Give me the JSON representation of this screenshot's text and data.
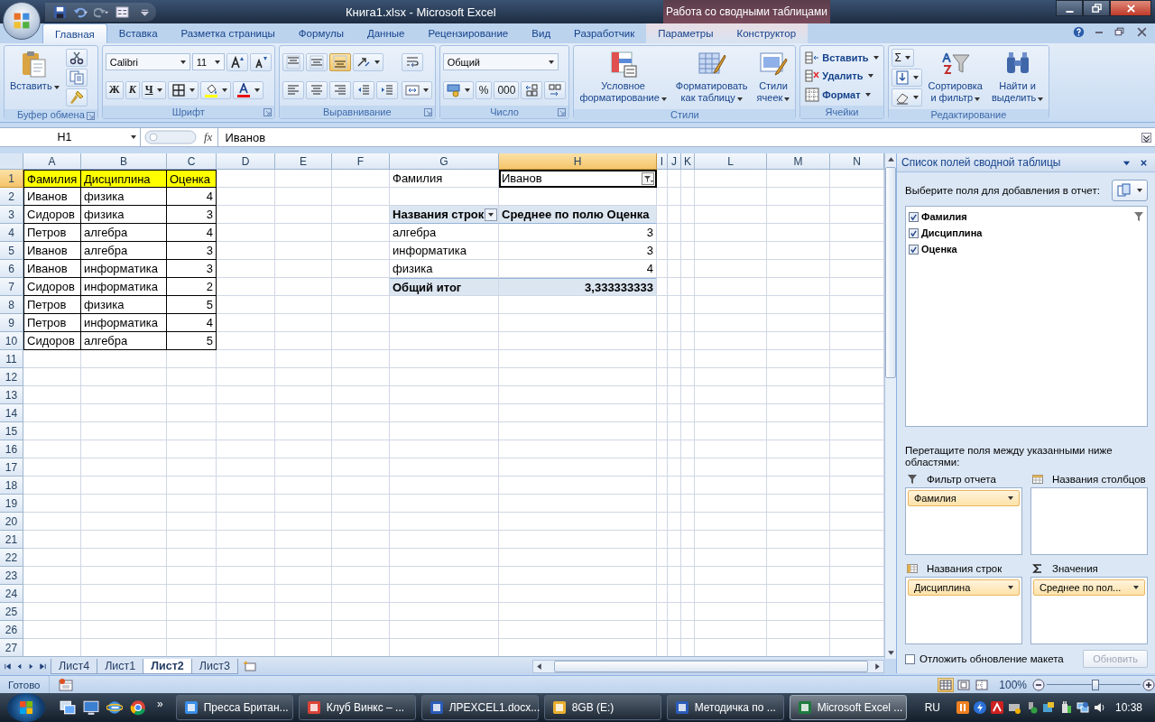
{
  "window": {
    "title": "Книга1.xlsx - Microsoft Excel",
    "context_group": "Работа со сводными таблицами"
  },
  "ribbon": {
    "tabs": [
      {
        "label": "Главная",
        "selected": true,
        "contextual": false
      },
      {
        "label": "Вставка",
        "selected": false,
        "contextual": false
      },
      {
        "label": "Разметка страницы",
        "selected": false,
        "contextual": false
      },
      {
        "label": "Формулы",
        "selected": false,
        "contextual": false
      },
      {
        "label": "Данные",
        "selected": false,
        "contextual": false
      },
      {
        "label": "Рецензирование",
        "selected": false,
        "contextual": false
      },
      {
        "label": "Вид",
        "selected": false,
        "contextual": false
      },
      {
        "label": "Разработчик",
        "selected": false,
        "contextual": false
      },
      {
        "label": "Параметры",
        "selected": false,
        "contextual": true
      },
      {
        "label": "Конструктор",
        "selected": false,
        "contextual": true
      }
    ],
    "groups": [
      {
        "label": "Буфер обмена",
        "launcher": true,
        "columns": [
          [
            [
              {
                "kind": "large",
                "label": "Вставить",
                "dropdown": true
              }
            ]
          ],
          [
            [
              {
                "kind": "icon",
                "dropdown": false
              }
            ],
            [
              {
                "kind": "icon",
                "dropdown": false
              }
            ],
            [
              {
                "kind": "icon",
                "dropdown": false
              }
            ]
          ]
        ]
      },
      {
        "label": "Шрифт",
        "launcher": true,
        "columns": [
          [
            [
              {
                "kind": "combo",
                "value": "Calibri",
                "wide": true
              },
              {
                "kind": "combo",
                "value": "11",
                "wide": false
              },
              {
                "kind": "icon",
                "dropdown": false
              },
              {
                "kind": "icon",
                "dropdown": false
              }
            ],
            [
              {
                "kind": "text",
                "label": "Ж",
                "dropdown": false
              },
              {
                "kind": "text",
                "label": "К",
                "dropdown": false
              },
              {
                "kind": "text",
                "label": "Ч",
                "dropdown": true
              },
              {
                "kind": "icon",
                "dropdown": true
              },
              {
                "kind": "icon",
                "dropdown": true
              },
              {
                "kind": "icon",
                "dropdown": true
              }
            ]
          ]
        ]
      },
      {
        "label": "Выравнивание",
        "launcher": true,
        "columns": [
          [
            [
              {
                "kind": "icon",
                "dropdown": false,
                "on": false
              },
              {
                "kind": "icon",
                "dropdown": false,
                "on": false
              },
              {
                "kind": "icon",
                "dropdown": false,
                "on": true
              },
              {
                "kind": "icon",
                "dropdown": true,
                "on": false
              }
            ],
            [
              {
                "kind": "icon",
                "dropdown": false,
                "on": false
              },
              {
                "kind": "icon",
                "dropdown": false,
                "on": false
              },
              {
                "kind": "icon",
                "dropdown": false,
                "on": false
              },
              {
                "kind": "icon",
                "dropdown": false,
                "on": false
              },
              {
                "kind": "icon",
                "dropdown": false,
                "on": false
              }
            ]
          ],
          [
            [
              {
                "kind": "icon",
                "dropdown": false
              }
            ],
            [
              {
                "kind": "icon",
                "dropdown": true
              }
            ]
          ]
        ]
      },
      {
        "label": "Число",
        "launcher": true,
        "columns": [
          [
            [
              {
                "kind": "combo",
                "value": "Общий",
                "wide": true
              }
            ],
            [
              {
                "kind": "icon",
                "dropdown": true
              },
              {
                "kind": "text",
                "label": "%",
                "dropdown": false
              },
              {
                "kind": "text",
                "label": "000",
                "dropdown": false
              },
              {
                "kind": "icon",
                "dropdown": false
              },
              {
                "kind": "icon",
                "dropdown": false
              }
            ]
          ]
        ]
      },
      {
        "label": "Стили",
        "launcher": false,
        "columns": [
          [
            [
              {
                "kind": "large",
                "label": "Условное\nформатирование",
                "dropdown": true
              }
            ]
          ],
          [
            [
              {
                "kind": "large",
                "label": "Форматировать\nкак таблицу",
                "dropdown": true
              }
            ]
          ],
          [
            [
              {
                "kind": "large",
                "label": "Стили\nячеек",
                "dropdown": true
              }
            ]
          ]
        ]
      },
      {
        "label": "Ячейки",
        "launcher": false,
        "columns": [
          [
            [
              {
                "kind": "small",
                "label": "Вставить",
                "dropdown": true
              }
            ],
            [
              {
                "kind": "small",
                "label": "Удалить",
                "dropdown": true
              }
            ],
            [
              {
                "kind": "small",
                "label": "Формат",
                "dropdown": true
              }
            ]
          ]
        ]
      },
      {
        "label": "Редактирование",
        "launcher": false,
        "columns": [
          [
            [
              {
                "kind": "text",
                "label": "Σ",
                "dropdown": true
              }
            ],
            [
              {
                "kind": "icon",
                "dropdown": true
              }
            ],
            [
              {
                "kind": "icon",
                "dropdown": true
              }
            ]
          ],
          [
            [
              {
                "kind": "large",
                "label": "Сортировка\nи фильтр",
                "dropdown": true
              }
            ]
          ],
          [
            [
              {
                "kind": "large",
                "label": "Найти и\nвыделить",
                "dropdown": true
              }
            ]
          ]
        ]
      }
    ]
  },
  "formula_bar": {
    "name_box": "H1",
    "function_label": "fx",
    "value": "Иванов"
  },
  "grid": {
    "columns": [
      {
        "label": "A",
        "selected": false
      },
      {
        "label": "B",
        "selected": false
      },
      {
        "label": "C",
        "selected": false
      },
      {
        "label": "D",
        "selected": false
      },
      {
        "label": "E",
        "selected": false
      },
      {
        "label": "F",
        "selected": false
      },
      {
        "label": "G",
        "selected": false
      },
      {
        "label": "H",
        "selected": true
      },
      {
        "label": "I",
        "selected": false
      },
      {
        "label": "J",
        "selected": false
      },
      {
        "label": "K",
        "selected": false
      },
      {
        "label": "L",
        "selected": false
      },
      {
        "label": "M",
        "selected": false
      },
      {
        "label": "N",
        "selected": false
      }
    ],
    "rows": [
      {
        "header": "1",
        "selected": true,
        "cells": [
          {
            "text": "Фамилия",
            "kind": "header",
            "selected": false
          },
          {
            "text": "Дисциплина",
            "kind": "header",
            "selected": false
          },
          {
            "text": "Оценка",
            "kind": "header",
            "selected": false
          },
          null,
          null,
          null,
          {
            "text": "Фамилия",
            "kind": "label",
            "selected": false
          },
          {
            "text": "Иванов",
            "kind": "filter",
            "selected": true
          },
          null,
          null,
          null,
          null,
          null,
          null
        ]
      },
      {
        "header": "2",
        "selected": false,
        "cells": [
          {
            "text": "Иванов",
            "kind": "text",
            "selected": false
          },
          {
            "text": "физика",
            "kind": "text",
            "selected": false
          },
          {
            "text": "4",
            "kind": "number",
            "selected": false
          },
          null,
          null,
          null,
          null,
          null,
          null,
          null,
          null,
          null,
          null,
          null
        ]
      },
      {
        "header": "3",
        "selected": false,
        "cells": [
          {
            "text": "Сидоров",
            "kind": "text",
            "selected": false
          },
          {
            "text": "физика",
            "kind": "text",
            "selected": false
          },
          {
            "text": "3",
            "kind": "number",
            "selected": false
          },
          null,
          null,
          null,
          {
            "text": "Названия строк",
            "kind": "rowheading",
            "selected": false
          },
          {
            "text": "Среднее по полю Оценка",
            "kind": "heading",
            "selected": false
          },
          null,
          null,
          null,
          null,
          null,
          null
        ]
      },
      {
        "header": "4",
        "selected": false,
        "cells": [
          {
            "text": "Петров",
            "kind": "text",
            "selected": false
          },
          {
            "text": "алгебра",
            "kind": "text",
            "selected": false
          },
          {
            "text": "4",
            "kind": "number",
            "selected": false
          },
          null,
          null,
          null,
          {
            "text": "алгебра",
            "kind": "item",
            "selected": false
          },
          {
            "text": "3",
            "kind": "value",
            "selected": false
          },
          null,
          null,
          null,
          null,
          null,
          null
        ]
      },
      {
        "header": "5",
        "selected": false,
        "cells": [
          {
            "text": "Иванов",
            "kind": "text",
            "selected": false
          },
          {
            "text": "алгебра",
            "kind": "text",
            "selected": false
          },
          {
            "text": "3",
            "kind": "number",
            "selected": false
          },
          null,
          null,
          null,
          {
            "text": "информатика",
            "kind": "item",
            "selected": false
          },
          {
            "text": "3",
            "kind": "value",
            "selected": false
          },
          null,
          null,
          null,
          null,
          null,
          null
        ]
      },
      {
        "header": "6",
        "selected": false,
        "cells": [
          {
            "text": "Иванов",
            "kind": "text",
            "selected": false
          },
          {
            "text": "информатика",
            "kind": "text",
            "selected": false
          },
          {
            "text": "3",
            "kind": "number",
            "selected": false
          },
          null,
          null,
          null,
          {
            "text": "физика",
            "kind": "item",
            "selected": false
          },
          {
            "text": "4",
            "kind": "value",
            "selected": false
          },
          null,
          null,
          null,
          null,
          null,
          null
        ]
      },
      {
        "header": "7",
        "selected": false,
        "cells": [
          {
            "text": "Сидоров",
            "kind": "text",
            "selected": false
          },
          {
            "text": "информатика",
            "kind": "text",
            "selected": false
          },
          {
            "text": "2",
            "kind": "number",
            "selected": false
          },
          null,
          null,
          null,
          {
            "text": "Общий итог",
            "kind": "total",
            "selected": false
          },
          {
            "text": "3,333333333",
            "kind": "totalvalue",
            "selected": false
          },
          null,
          null,
          null,
          null,
          null,
          null
        ]
      },
      {
        "header": "8",
        "selected": false,
        "cells": [
          {
            "text": "Петров",
            "kind": "text",
            "selected": false
          },
          {
            "text": "физика",
            "kind": "text",
            "selected": false
          },
          {
            "text": "5",
            "kind": "number",
            "selected": false
          },
          null,
          null,
          null,
          null,
          null,
          null,
          null,
          null,
          null,
          null,
          null
        ]
      },
      {
        "header": "9",
        "selected": false,
        "cells": [
          {
            "text": "Петров",
            "kind": "text",
            "selected": false
          },
          {
            "text": "информатика",
            "kind": "text",
            "selected": false
          },
          {
            "text": "4",
            "kind": "number",
            "selected": false
          },
          null,
          null,
          null,
          null,
          null,
          null,
          null,
          null,
          null,
          null,
          null
        ]
      },
      {
        "header": "10",
        "selected": false,
        "cells": [
          {
            "text": "Сидоров",
            "kind": "text",
            "selected": false
          },
          {
            "text": "алгебра",
            "kind": "text",
            "selected": false
          },
          {
            "text": "5",
            "kind": "number",
            "selected": false
          },
          null,
          null,
          null,
          null,
          null,
          null,
          null,
          null,
          null,
          null,
          null
        ]
      },
      {
        "header": "11",
        "selected": false
      },
      {
        "header": "12",
        "selected": false
      },
      {
        "header": "13",
        "selected": false
      },
      {
        "header": "14",
        "selected": false
      },
      {
        "header": "15",
        "selected": false
      },
      {
        "header": "16",
        "selected": false
      },
      {
        "header": "17",
        "selected": false
      },
      {
        "header": "18",
        "selected": false
      },
      {
        "header": "19",
        "selected": false
      },
      {
        "header": "20",
        "selected": false
      },
      {
        "header": "21",
        "selected": false
      },
      {
        "header": "22",
        "selected": false
      },
      {
        "header": "23",
        "selected": false
      },
      {
        "header": "24",
        "selected": false
      },
      {
        "header": "25",
        "selected": false
      },
      {
        "header": "26",
        "selected": false
      },
      {
        "header": "27",
        "selected": false
      }
    ]
  },
  "sheet_tabs": [
    {
      "label": "Лист4",
      "selected": false
    },
    {
      "label": "Лист1",
      "selected": false
    },
    {
      "label": "Лист2",
      "selected": true
    },
    {
      "label": "Лист3",
      "selected": false
    }
  ],
  "pivot_panel": {
    "title": "Список полей сводной таблицы",
    "prompt": "Выберите поля для добавления в отчет:",
    "fields": [
      {
        "label": "Фамилия",
        "checked": true,
        "filtered": true
      },
      {
        "label": "Дисциплина",
        "checked": true,
        "filtered": false
      },
      {
        "label": "Оценка",
        "checked": true,
        "filtered": false
      }
    ],
    "drag_hint": "Перетащите поля между указанными ниже областями:",
    "areas": [
      {
        "kind": "filter",
        "title": "Фильтр отчета",
        "items": [
          "Фамилия"
        ]
      },
      {
        "kind": "columns",
        "title": "Названия столбцов"
      },
      {
        "kind": "rows",
        "title": "Названия строк",
        "items": [
          "Дисциплина"
        ]
      },
      {
        "kind": "values",
        "title": "Значения",
        "items": [
          "Среднее по пол..."
        ]
      }
    ],
    "defer": {
      "label": "Отложить обновление макета",
      "checked": false
    },
    "update_button": {
      "label": "Обновить",
      "disabled": true
    }
  },
  "status_bar": {
    "status": "Готово",
    "views": [
      {
        "selected": true
      },
      {
        "selected": false
      },
      {
        "selected": false
      }
    ],
    "zoom": "100%",
    "zoom_slider": {
      "level": 0.52
    }
  },
  "taskbar": {
    "overflow": "»",
    "tasks": [
      {
        "label": "Пресса Британ...",
        "selected": false
      },
      {
        "label": "Клуб Винкс – ...",
        "selected": false
      },
      {
        "label": "ЛРEXCEL1.docx...",
        "selected": false
      },
      {
        "label": "8GB (E:)",
        "selected": false
      },
      {
        "label": "Методичка по ...",
        "selected": false
      },
      {
        "label": "Microsoft Excel ...",
        "selected": true
      }
    ],
    "language": "RU",
    "time": "10:38"
  }
}
